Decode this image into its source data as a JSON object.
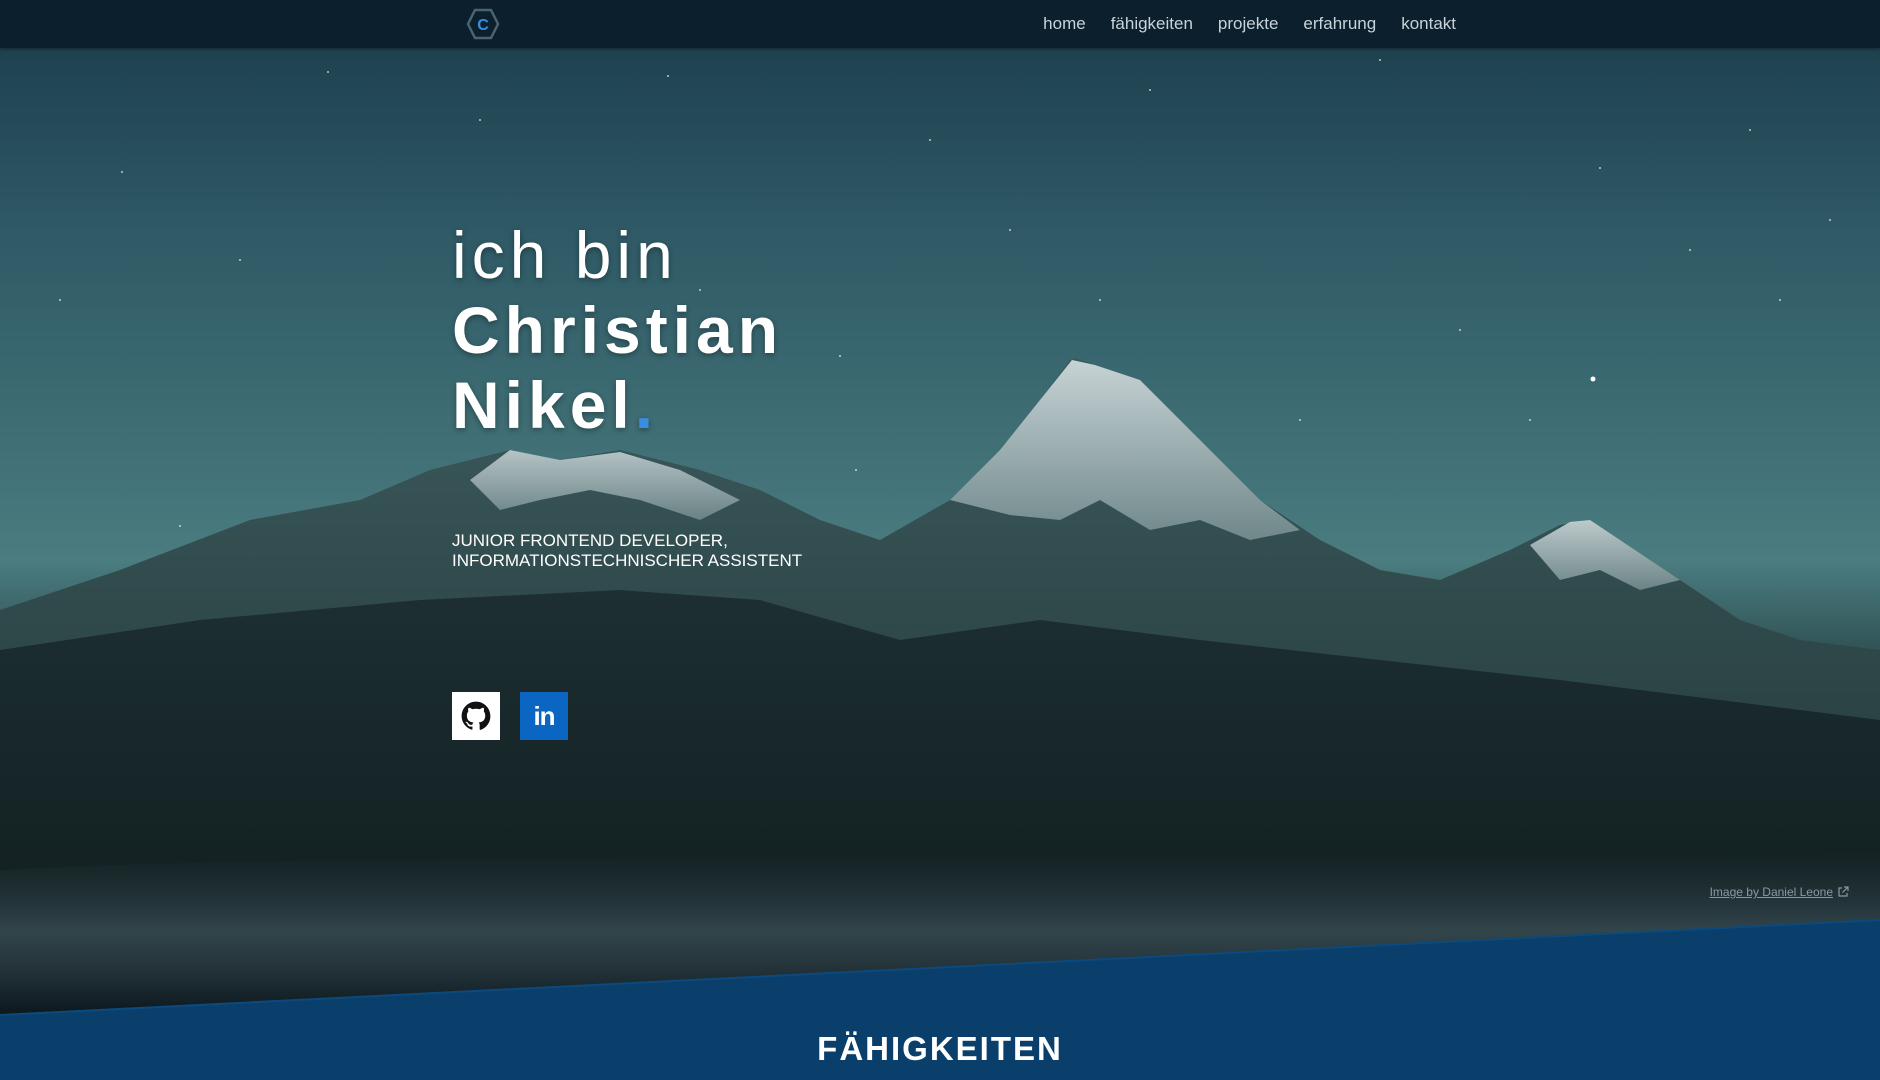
{
  "nav": {
    "logo_letter": "C",
    "links": [
      {
        "label": "home"
      },
      {
        "label": "fähigkeiten"
      },
      {
        "label": "projekte"
      },
      {
        "label": "erfahrung"
      },
      {
        "label": "kontakt"
      }
    ]
  },
  "hero": {
    "line1": "ich bin",
    "line2": "Christian",
    "line3": "Nikel",
    "dot": ".",
    "subtitle_line1": "JUNIOR FRONTEND DEVELOPER,",
    "subtitle_line2": "INFORMATIONSTECHNISCHER ASSISTENT",
    "socials": [
      {
        "name": "github",
        "icon": "github-icon"
      },
      {
        "name": "linkedin",
        "icon": "linkedin-icon",
        "label": "in"
      }
    ],
    "credit": "Image by Daniel Leone"
  },
  "skills_section": {
    "title": "FÄHIGKEITEN"
  },
  "colors": {
    "nav_bg": "#0b1f2c",
    "accent": "#3a8de0",
    "section_bg": "#0a3f6b",
    "linkedin": "#0a66c2"
  }
}
